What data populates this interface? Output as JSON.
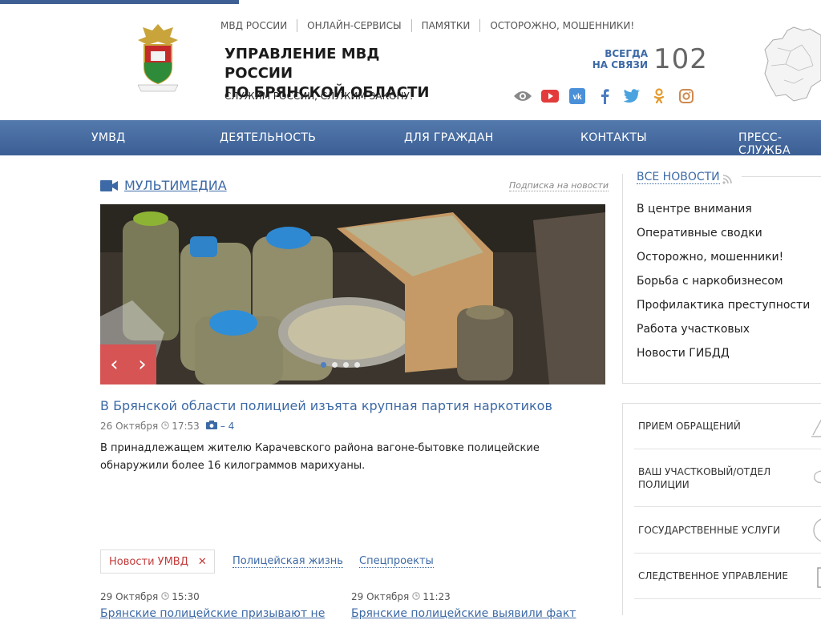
{
  "top_links": [
    "МВД России",
    "Онлайн-сервисы",
    "Памятки",
    "Осторожно, мошенники!"
  ],
  "header": {
    "title_line1": "УПРАВЛЕНИЕ МВД РОССИИ",
    "title_line2": "ПО БРЯНСКОЙ ОБЛАСТИ",
    "motto": "СЛУЖИМ РОССИИ, СЛУЖИМ ЗАКОНУ!",
    "always_line1": "ВСЕГДА",
    "always_line2": "НА СВЯЗИ",
    "phone": "102"
  },
  "social_icons": [
    "eye-icon",
    "youtube-icon",
    "vk-icon",
    "facebook-icon",
    "twitter-icon",
    "odnoklassniki-icon",
    "instagram-icon"
  ],
  "nav": [
    "УМВД",
    "ДЕЯТЕЛЬНОСТЬ",
    "ДЛЯ ГРАЖДАН",
    "КОНТАКТЫ",
    "ПРЕСС-СЛУЖБА"
  ],
  "multimedia": {
    "title": "МУЛЬТИМЕДИА",
    "subscribe": "Подписка на новости",
    "slide_count": 4,
    "active_slide": 1
  },
  "featured": {
    "title": "В Брянской области полицией изъята крупная партия наркотиков",
    "date": "26 Октября",
    "time": "17:53",
    "photo_count": "– 4",
    "text": "В принадлежащем жителю Карачевского района вагоне-бытовке полицейские обнаружили более 16 килограммов марихуаны."
  },
  "tabs": {
    "active": "Новости УМВД",
    "others": [
      "Полицейская жизнь",
      "Спецпроекты"
    ]
  },
  "bottom_news": [
    {
      "date": "29 Октября",
      "time": "15:30",
      "title": "Брянские полицейские призывают не"
    },
    {
      "date": "29 Октября",
      "time": "11:23",
      "title": "Брянские полицейские выявили факт"
    }
  ],
  "sidebar": {
    "all_news": "ВСЕ НОВОСТИ",
    "categories": [
      "В центре внимания",
      "Оперативные сводки",
      "Осторожно, мошенники!",
      "Борьба с наркобизнесом",
      "Профилактика преступности",
      "Работа участковых",
      "Новости ГИБДД"
    ]
  },
  "services": [
    "ПРИЕМ ОБРАЩЕНИЙ",
    "ВАШ УЧАСТКОВЫЙ/ОТДЕЛ ПОЛИЦИИ",
    "ГОСУДАРСТВЕННЫЕ УСЛУГИ",
    "СЛЕДСТВЕННОЕ УПРАВЛЕНИЕ"
  ],
  "colors": {
    "nav": "#4a6fa5",
    "link": "#3d6aa6",
    "accent_red": "#d65454"
  }
}
